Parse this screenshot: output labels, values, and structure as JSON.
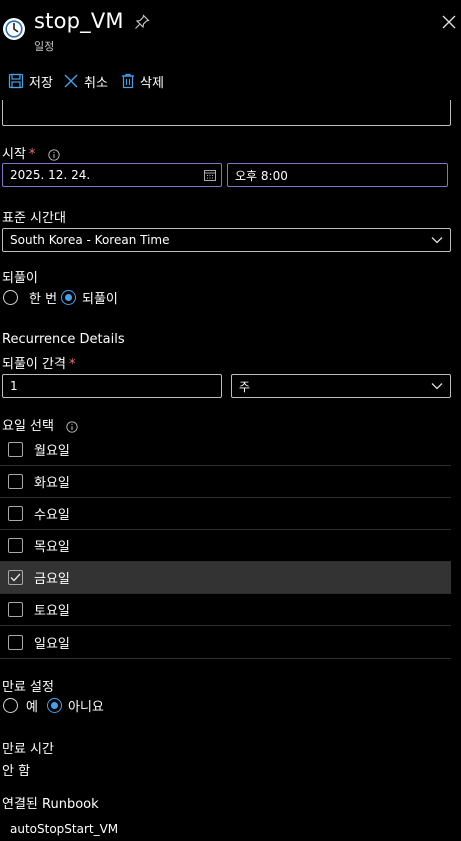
{
  "header": {
    "title": "stop_VM",
    "subtitle": "일정"
  },
  "toolbar": {
    "save_label": "저장",
    "discard_label": "취소",
    "delete_label": "삭제"
  },
  "start": {
    "label": "시작",
    "required_mark": "*",
    "date": "2025. 12. 24.",
    "time": "오후 8:00"
  },
  "timezone": {
    "label": "표준 시간대",
    "value": "South Korea - Korean Time"
  },
  "recurrence": {
    "label": "되풀이",
    "option_once": "한 번",
    "option_recurring": "되풀이",
    "selected": "recurring"
  },
  "recurrence_details": {
    "heading": "Recurrence Details",
    "interval_label": "되풀이 간격",
    "required_mark": "*",
    "interval_value": "1",
    "unit_value": "주"
  },
  "days": {
    "label": "요일 선택",
    "items": [
      {
        "label": "월요일",
        "checked": false
      },
      {
        "label": "화요일",
        "checked": false
      },
      {
        "label": "수요일",
        "checked": false
      },
      {
        "label": "목요일",
        "checked": false
      },
      {
        "label": "금요일",
        "checked": true
      },
      {
        "label": "토요일",
        "checked": false
      },
      {
        "label": "일요일",
        "checked": false
      }
    ]
  },
  "expiry": {
    "label": "만료 설정",
    "option_yes": "예",
    "option_no": "아니요",
    "selected": "no"
  },
  "expiry_time": {
    "label": "만료 시간",
    "value": "안 함"
  },
  "runbook": {
    "label": "연결된 Runbook",
    "value": "autoStopStart_VM"
  },
  "colors": {
    "accent": "#4aa0e8",
    "focus_border": "#8b6fc8",
    "required": "#f1707b",
    "selected_row": "#333333"
  }
}
